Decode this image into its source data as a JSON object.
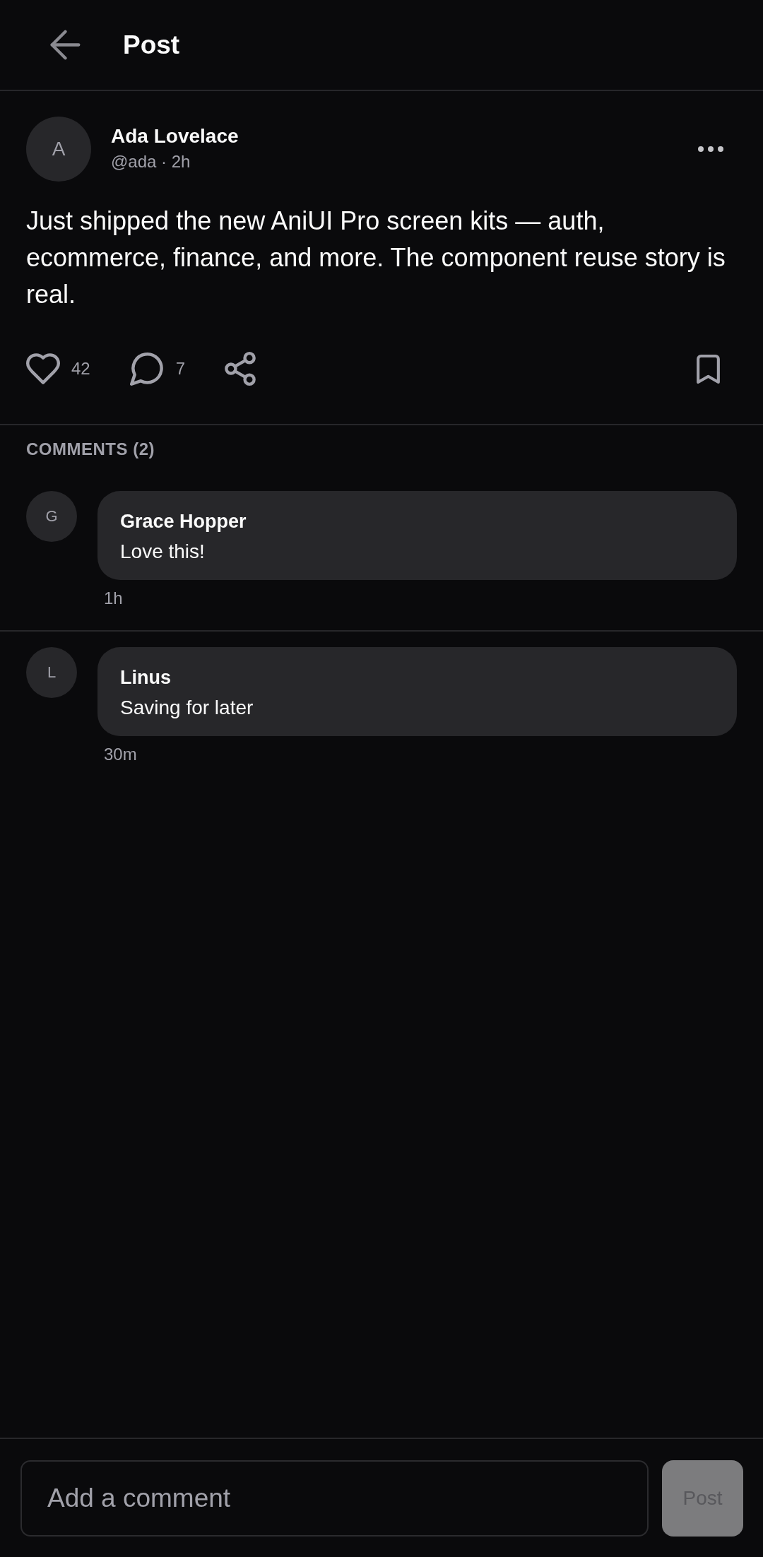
{
  "header": {
    "title": "Post"
  },
  "post": {
    "author": {
      "initial": "A",
      "name": "Ada Lovelace",
      "meta": "@ada · 2h"
    },
    "text": "Just shipped the new AniUI Pro screen kits — auth, ecommerce, finance, and more. The component reuse story is real.",
    "actions": {
      "liked": false,
      "likes": "42",
      "comments": "7",
      "bookmarked": false
    }
  },
  "comments_section": {
    "title": "COMMENTS (2)",
    "comments": [
      {
        "initial": "G",
        "name": "Grace Hopper",
        "text": "Love this!",
        "time": "1h"
      },
      {
        "initial": "L",
        "name": "Linus",
        "text": "Saving for later",
        "time": "30m"
      }
    ]
  },
  "composer": {
    "placeholder": "Add a comment",
    "button": {
      "label": "Post",
      "disabled": true
    }
  }
}
